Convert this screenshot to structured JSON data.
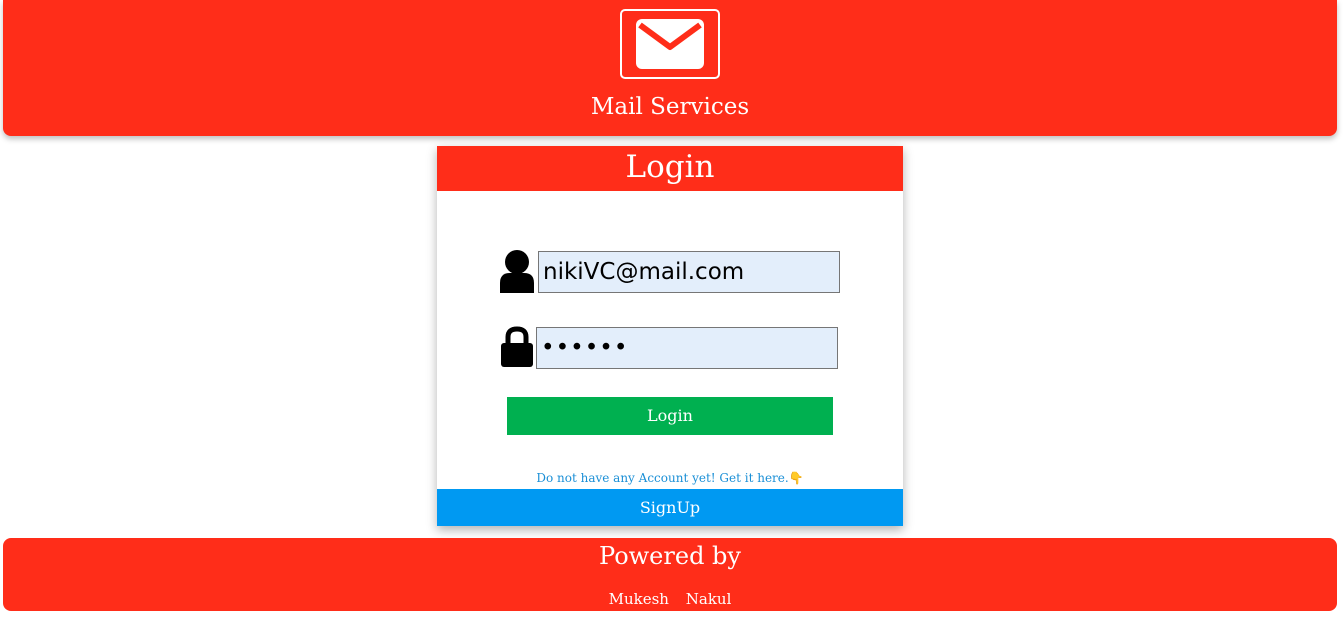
{
  "header": {
    "brand": "Mail Services",
    "logo_icon": "envelope-icon"
  },
  "login_card": {
    "title": "Login",
    "email_field": {
      "icon": "user-icon",
      "value": "nikiVC@mail.com"
    },
    "password_field": {
      "icon": "lock-icon",
      "value": "••••••"
    },
    "login_button": "Login",
    "signup_hint": "Do not have any Account yet! Get it here.👇",
    "signup_button": "SignUp"
  },
  "footer": {
    "title": "Powered by",
    "authors": [
      "Mukesh",
      "Nakul"
    ]
  },
  "colors": {
    "brand_red": "#ff2d19",
    "login_green": "#00b050",
    "signup_blue": "#0099f2",
    "input_bg": "#e3eefb",
    "link_blue": "#1a8fd6"
  }
}
